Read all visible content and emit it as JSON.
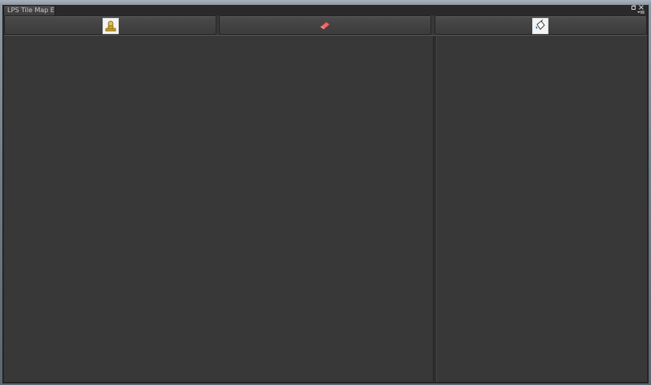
{
  "window": {
    "tab_title": "LPS Tile Map Ed",
    "controls": {
      "restore_icon": "restore-icon",
      "close_icon": "close-icon",
      "menu_icon": "tab-menu-icon"
    }
  },
  "toolbar": {
    "buttons": [
      {
        "id": "stamp",
        "icon": "stamp-tool-icon"
      },
      {
        "id": "eraser",
        "icon": "eraser-tool-icon"
      },
      {
        "id": "fill",
        "icon": "paint-bucket-icon"
      }
    ]
  },
  "colors": {
    "panel_bg": "#383838",
    "titlebar_bg": "#2a2a2a",
    "eraser": "#e86a6a",
    "stamp": "#c9a227"
  }
}
